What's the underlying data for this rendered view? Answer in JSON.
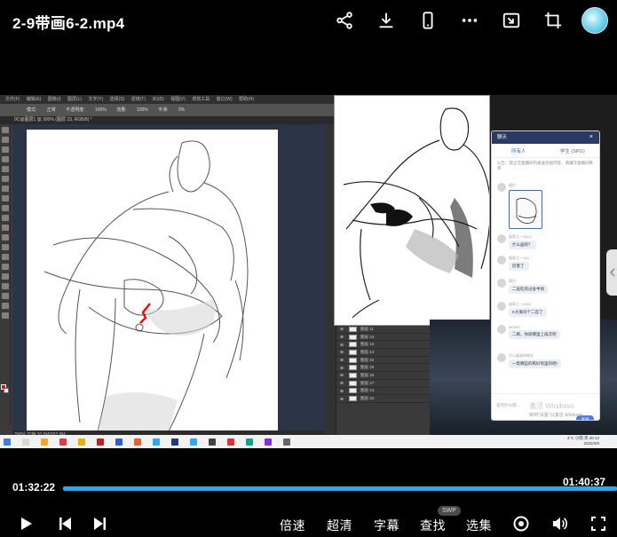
{
  "player": {
    "file_title": "2-9带画6-2.mp4",
    "current_time": "01:32:22",
    "total_time": "01:40:37",
    "progress": 0.918,
    "controls": {
      "speed": "倍速",
      "quality": "超清",
      "subtitle": "字幕",
      "search": "查找",
      "search_badge": "SWP",
      "episodes": "选集"
    }
  },
  "photoshop": {
    "menu": [
      "文件(F)",
      "编辑(E)",
      "图像(I)",
      "图层(L)",
      "文字(Y)",
      "选择(S)",
      "滤镜(T)",
      "3D(D)",
      "视图(V)",
      "增效工具",
      "窗口(W)",
      "帮助(H)"
    ],
    "options": [
      "模式:",
      "正常",
      "不透明度:",
      "100%",
      "流量:",
      "100%",
      "平滑:",
      "0%"
    ],
    "doc_tab": "0C@图层1 @ 300% (图层 23, RGB/8) *",
    "status": "200%   文档:10.5M/207.8M",
    "layers": [
      "图层 11",
      "图层 24",
      "图层 10",
      "图层 14",
      "图层 22",
      "图层 25",
      "图层 26",
      "图层 27",
      "图层 13",
      "图层 22"
    ]
  },
  "chat": {
    "title": "聊天",
    "tabs": [
      "所有人",
      "学生 (SPG)"
    ],
    "notice": "公告：禁止在直播间内发送违规内容，请遵守直播间秩序",
    "messages": [
      {
        "name": "图片",
        "text": ""
      },
      {
        "name": "画家之一1514",
        "text": "什么画的？"
      },
      {
        "name": "画家之一140",
        "text": "厉害了"
      },
      {
        "name": "萌白",
        "text": "二层吃的过会半场"
      },
      {
        "name": "画家之一2920",
        "text": "K大来问个二首了"
      },
      {
        "name": "MOMO",
        "text": "二刷，你就哪里上再次吧"
      },
      {
        "name": "七公画画的练好",
        "text": "一帮哪些的练好饰里的吧!"
      }
    ],
    "input_placeholder": "说点什么吧...",
    "send": "发送"
  },
  "windows": {
    "activate_line1": "激活 Windows",
    "activate_line2": "转到\"设置\"以激活 Windows。",
    "tray_time": "20:12",
    "tray_date": "2020/3/9",
    "tray_weather": "4°C 小雨",
    "tray_lang": "英"
  },
  "colors": {
    "accent": "#2aa8ee",
    "brush_fg": "#e01010"
  },
  "icons": {
    "share": "share-icon",
    "download": "download-icon",
    "phone": "phone-icon",
    "more": "more-icon",
    "pip": "picture-in-picture-icon",
    "crop": "crop-icon"
  }
}
